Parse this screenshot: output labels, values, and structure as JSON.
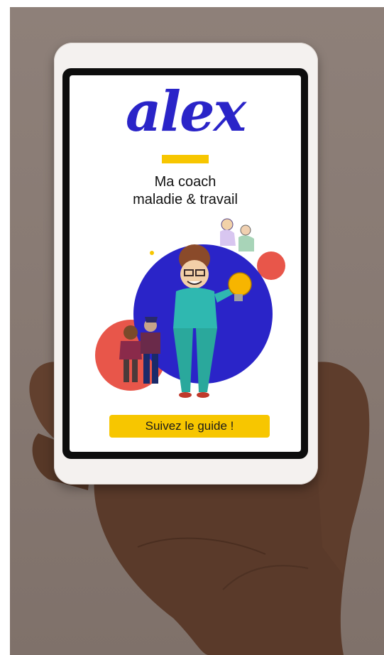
{
  "app": {
    "logo_text": "alex",
    "subtitle_line1": "Ma coach",
    "subtitle_line2": "maladie & travail",
    "cta_label": "Suivez le guide !"
  },
  "colors": {
    "brand_blue": "#2a24c8",
    "accent_yellow": "#f7c600",
    "accent_coral": "#e8564a",
    "background": "#8e8079"
  },
  "icons": [
    "lightbulb-icon"
  ]
}
